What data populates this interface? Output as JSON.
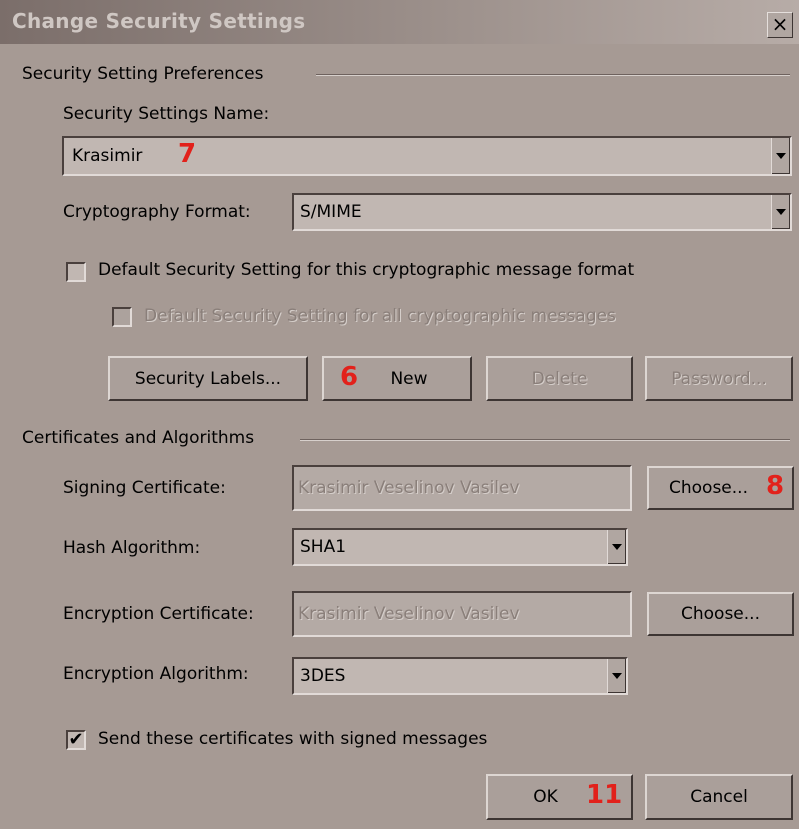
{
  "window": {
    "title": "Change Security Settings",
    "close_glyph": "×"
  },
  "preferences": {
    "group_label": "Security Setting Preferences",
    "name_label": "Security Settings Name:",
    "name_value": "Krasimir",
    "crypto_label": "Cryptography Format:",
    "crypto_value": "S/MIME",
    "default_format_label": "Default Security Setting for this cryptographic message format",
    "default_format_checked": false,
    "default_all_label": "Default Security Setting for all cryptographic messages",
    "default_all_checked": false,
    "buttons": {
      "security_labels": "Security Labels...",
      "new": "New",
      "delete": "Delete",
      "password": "Password..."
    }
  },
  "certificates": {
    "group_label": "Certificates and Algorithms",
    "signing_label": "Signing Certificate:",
    "signing_value": "Krasimir Veselinov Vasilev",
    "choose_signing": "Choose...",
    "hash_label": "Hash Algorithm:",
    "hash_value": "SHA1",
    "encryption_cert_label": "Encryption Certificate:",
    "encryption_cert_value": "Krasimir Veselinov Vasilev",
    "choose_encryption": "Choose...",
    "encryption_alg_label": "Encryption Algorithm:",
    "encryption_alg_value": "3DES",
    "send_certs_label": "Send these certificates with signed messages",
    "send_certs_checked": true,
    "send_certs_check_glyph": "✔"
  },
  "footer": {
    "ok": "OK",
    "cancel": "Cancel"
  },
  "annotations": {
    "m7": "7",
    "m6": "6",
    "m8": "8",
    "m11": "11"
  },
  "colors": {
    "marker": "#e2211b",
    "dialog_bg": "#a69a94"
  }
}
